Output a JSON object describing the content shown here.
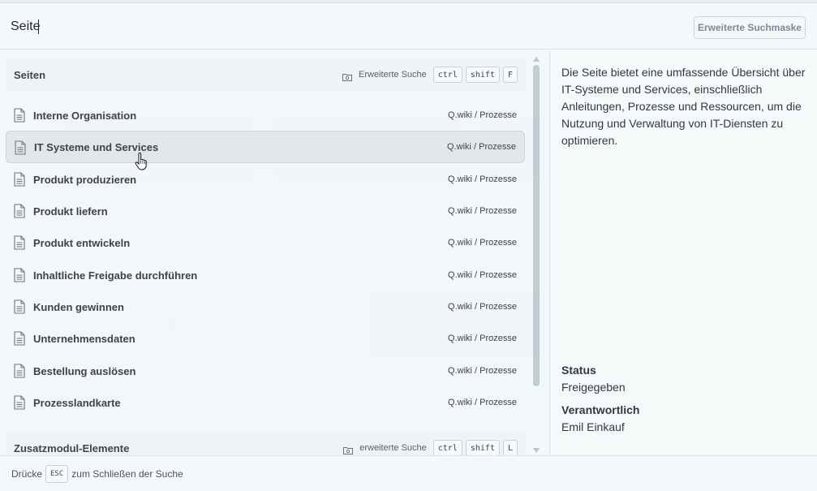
{
  "search": {
    "value": "Seite",
    "advanced_mask_label": "Erweiterte Suchmaske"
  },
  "sections": [
    {
      "title": "Seiten",
      "tool_label": "Erweiterte Suche",
      "shortcut": [
        "ctrl",
        "shift",
        "F"
      ]
    },
    {
      "title": "Zusatzmodul-Elemente",
      "tool_label": "erweiterte Suche",
      "shortcut": [
        "ctrl",
        "shift",
        "L"
      ]
    }
  ],
  "results": [
    {
      "label": "Interne Organisation",
      "path": "Q.wiki / Prozesse"
    },
    {
      "label": "IT Systeme und Services",
      "path": "Q.wiki / Prozesse"
    },
    {
      "label": "Produkt produzieren",
      "path": "Q.wiki / Prozesse"
    },
    {
      "label": "Produkt liefern",
      "path": "Q.wiki / Prozesse"
    },
    {
      "label": "Produkt entwickeln",
      "path": "Q.wiki / Prozesse"
    },
    {
      "label": "Inhaltliche Freigabe durchführen",
      "path": "Q.wiki / Prozesse"
    },
    {
      "label": "Kunden gewinnen",
      "path": "Q.wiki / Prozesse"
    },
    {
      "label": "Unternehmensdaten",
      "path": "Q.wiki / Prozesse"
    },
    {
      "label": "Bestellung auslösen",
      "path": "Q.wiki / Prozesse"
    },
    {
      "label": "Prozesslandkarte",
      "path": "Q.wiki / Prozesse"
    }
  ],
  "preview": {
    "description": "Die Seite bietet eine umfassende Übersicht über IT-Systeme und Services, einschließlich Anleitungen, Prozesse und Ressourcen, um die Nutzung und Verwaltung von IT-Diensten zu optimieren.",
    "status_label": "Status",
    "status_value": "Freigegeben",
    "owner_label": "Verantwortlich",
    "owner_value": "Emil Einkauf"
  },
  "footer": {
    "prefix": "Drücke",
    "key": "ESC",
    "suffix": "zum Schließen der Suche"
  },
  "colors": {
    "accent_bg": "#d4e6f1",
    "active_row": "#e2e6e9",
    "text": "#2f3a44"
  },
  "icons": {
    "result": "page-icon",
    "section_tool": "folder-search-icon",
    "cursor": "hand-cursor-icon"
  }
}
